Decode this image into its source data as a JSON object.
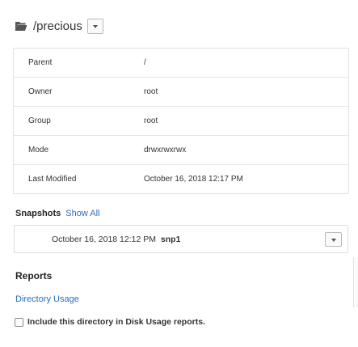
{
  "header": {
    "path": "/precious",
    "folder_icon": "folder-open-icon",
    "dropdown_icon": "caret-down-icon"
  },
  "properties": [
    {
      "key": "Parent",
      "value": "/"
    },
    {
      "key": "Owner",
      "value": "root"
    },
    {
      "key": "Group",
      "value": "root"
    },
    {
      "key": "Mode",
      "value": "drwxrwxrwx"
    },
    {
      "key": "Last Modified",
      "value": "October 16, 2018 12:17 PM"
    }
  ],
  "snapshots": {
    "label": "Snapshots",
    "show_all": "Show All",
    "selected_date": "October 16, 2018 12:12 PM",
    "selected_name": "snp1"
  },
  "reports": {
    "title": "Reports",
    "directory_usage": "Directory Usage",
    "include_label": "Include this directory in Disk Usage reports.",
    "include_checked": false
  },
  "colors": {
    "link": "#2a6fc0",
    "text": "#333333",
    "border": "#e0e0e0"
  }
}
